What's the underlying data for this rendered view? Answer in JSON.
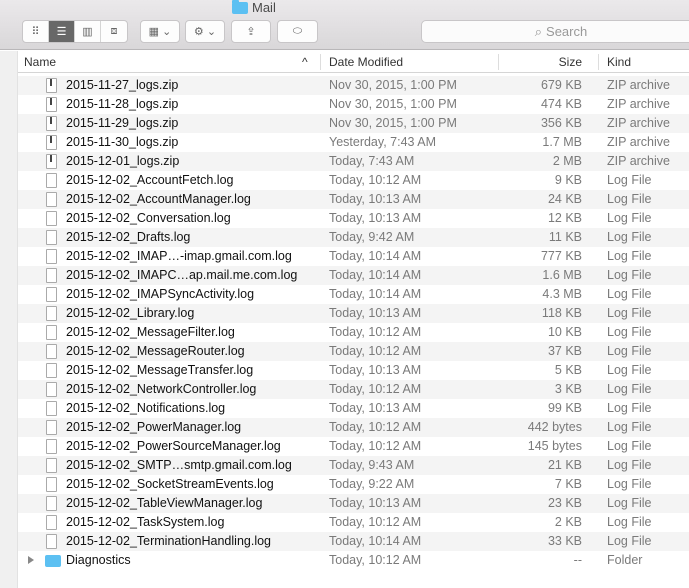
{
  "window": {
    "title": "Mail"
  },
  "toolbar": {
    "search_placeholder": "Search"
  },
  "columns": {
    "name": "Name",
    "date": "Date Modified",
    "size": "Size",
    "kind": "Kind"
  },
  "files": [
    {
      "name": "2015-11-27_logs.zip",
      "date": "Nov 30, 2015, 1:00 PM",
      "size": "679 KB",
      "kind": "ZIP archive",
      "type": "zip"
    },
    {
      "name": "2015-11-28_logs.zip",
      "date": "Nov 30, 2015, 1:00 PM",
      "size": "474 KB",
      "kind": "ZIP archive",
      "type": "zip"
    },
    {
      "name": "2015-11-29_logs.zip",
      "date": "Nov 30, 2015, 1:00 PM",
      "size": "356 KB",
      "kind": "ZIP archive",
      "type": "zip"
    },
    {
      "name": "2015-11-30_logs.zip",
      "date": "Yesterday, 7:43 AM",
      "size": "1.7 MB",
      "kind": "ZIP archive",
      "type": "zip"
    },
    {
      "name": "2015-12-01_logs.zip",
      "date": "Today, 7:43 AM",
      "size": "2 MB",
      "kind": "ZIP archive",
      "type": "zip"
    },
    {
      "name": "2015-12-02_AccountFetch.log",
      "date": "Today, 10:12 AM",
      "size": "9 KB",
      "kind": "Log File",
      "type": "log"
    },
    {
      "name": "2015-12-02_AccountManager.log",
      "date": "Today, 10:13 AM",
      "size": "24 KB",
      "kind": "Log File",
      "type": "log"
    },
    {
      "name": "2015-12-02_Conversation.log",
      "date": "Today, 10:13 AM",
      "size": "12 KB",
      "kind": "Log File",
      "type": "log"
    },
    {
      "name": "2015-12-02_Drafts.log",
      "date": "Today, 9:42 AM",
      "size": "11 KB",
      "kind": "Log File",
      "type": "log"
    },
    {
      "name": "2015-12-02_IMAP…-imap.gmail.com.log",
      "date": "Today, 10:14 AM",
      "size": "777 KB",
      "kind": "Log File",
      "type": "log"
    },
    {
      "name": "2015-12-02_IMAPC…ap.mail.me.com.log",
      "date": "Today, 10:14 AM",
      "size": "1.6 MB",
      "kind": "Log File",
      "type": "log"
    },
    {
      "name": "2015-12-02_IMAPSyncActivity.log",
      "date": "Today, 10:14 AM",
      "size": "4.3 MB",
      "kind": "Log File",
      "type": "log"
    },
    {
      "name": "2015-12-02_Library.log",
      "date": "Today, 10:13 AM",
      "size": "118 KB",
      "kind": "Log File",
      "type": "log"
    },
    {
      "name": "2015-12-02_MessageFilter.log",
      "date": "Today, 10:12 AM",
      "size": "10 KB",
      "kind": "Log File",
      "type": "log"
    },
    {
      "name": "2015-12-02_MessageRouter.log",
      "date": "Today, 10:12 AM",
      "size": "37 KB",
      "kind": "Log File",
      "type": "log"
    },
    {
      "name": "2015-12-02_MessageTransfer.log",
      "date": "Today, 10:13 AM",
      "size": "5 KB",
      "kind": "Log File",
      "type": "log"
    },
    {
      "name": "2015-12-02_NetworkController.log",
      "date": "Today, 10:12 AM",
      "size": "3 KB",
      "kind": "Log File",
      "type": "log"
    },
    {
      "name": "2015-12-02_Notifications.log",
      "date": "Today, 10:13 AM",
      "size": "99 KB",
      "kind": "Log File",
      "type": "log"
    },
    {
      "name": "2015-12-02_PowerManager.log",
      "date": "Today, 10:12 AM",
      "size": "442 bytes",
      "kind": "Log File",
      "type": "log"
    },
    {
      "name": "2015-12-02_PowerSourceManager.log",
      "date": "Today, 10:12 AM",
      "size": "145 bytes",
      "kind": "Log File",
      "type": "log"
    },
    {
      "name": "2015-12-02_SMTP…smtp.gmail.com.log",
      "date": "Today, 9:43 AM",
      "size": "21 KB",
      "kind": "Log File",
      "type": "log"
    },
    {
      "name": "2015-12-02_SocketStreamEvents.log",
      "date": "Today, 9:22 AM",
      "size": "7 KB",
      "kind": "Log File",
      "type": "log"
    },
    {
      "name": "2015-12-02_TableViewManager.log",
      "date": "Today, 10:13 AM",
      "size": "23 KB",
      "kind": "Log File",
      "type": "log"
    },
    {
      "name": "2015-12-02_TaskSystem.log",
      "date": "Today, 10:12 AM",
      "size": "2 KB",
      "kind": "Log File",
      "type": "log"
    },
    {
      "name": "2015-12-02_TerminationHandling.log",
      "date": "Today, 10:14 AM",
      "size": "33 KB",
      "kind": "Log File",
      "type": "log"
    },
    {
      "name": "Diagnostics",
      "date": "Today, 10:12 AM",
      "size": "--",
      "kind": "Folder",
      "type": "folder"
    }
  ]
}
